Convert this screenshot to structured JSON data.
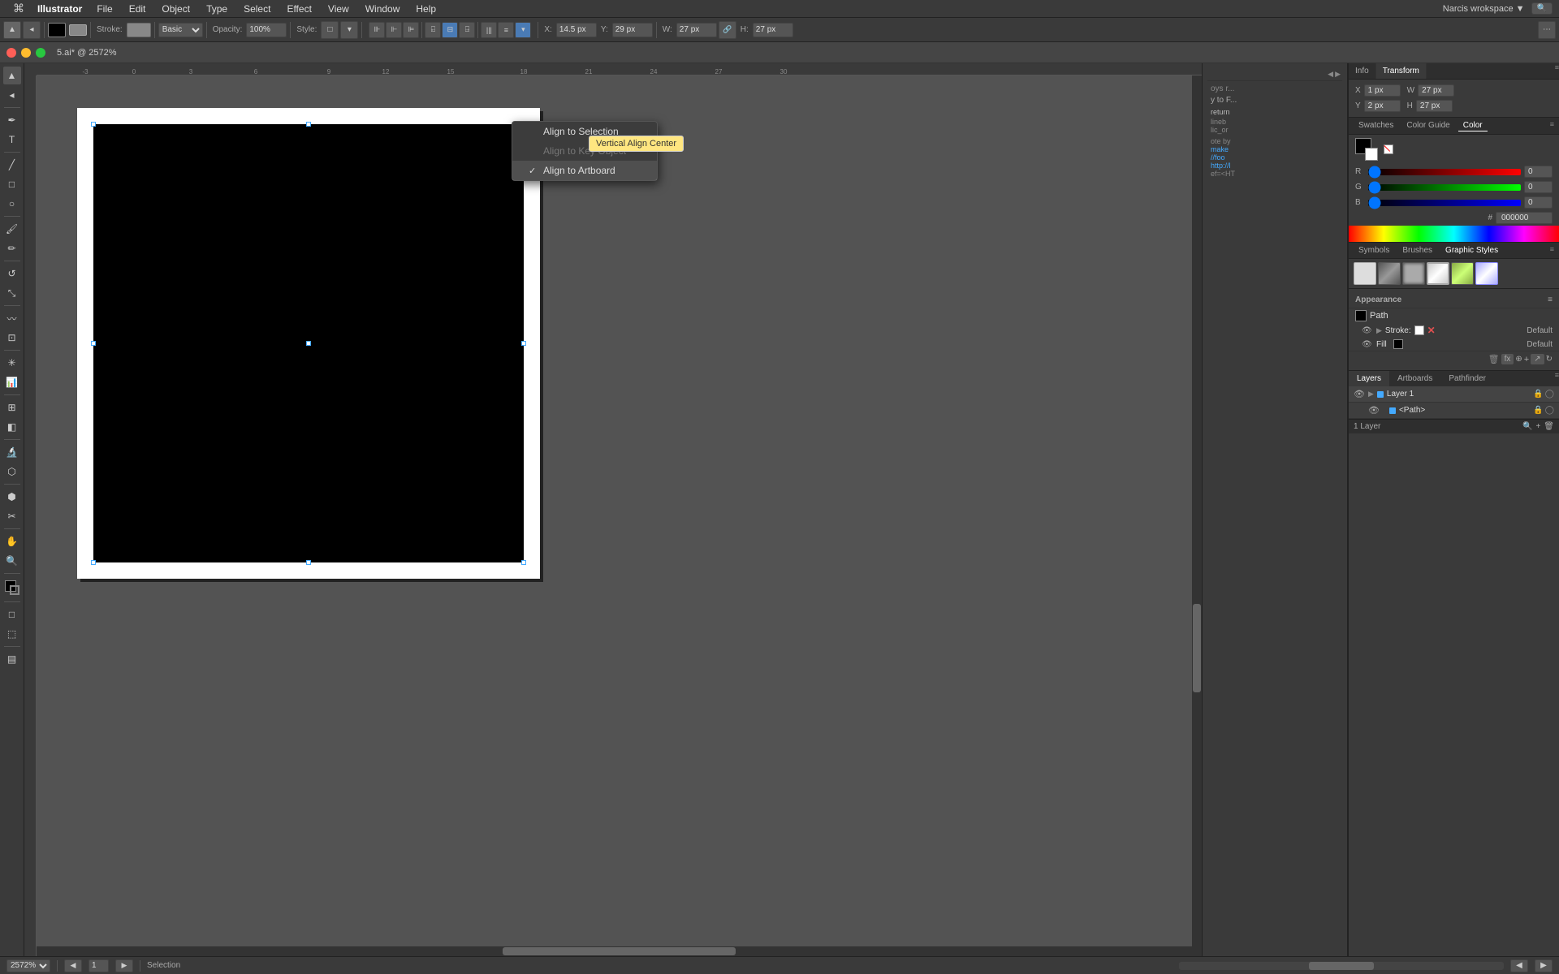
{
  "menubar": {
    "apple": "⌘",
    "app_name": "Illustrator",
    "items": [
      "File",
      "Edit",
      "Object",
      "Type",
      "Select",
      "Effect",
      "View",
      "Window",
      "Help"
    ],
    "right": "Narcis wrokspace ▼",
    "search_placeholder": "Search"
  },
  "toolbar": {
    "stroke_label": "Stroke:",
    "stroke_color": "#888",
    "opacity_label": "Opacity:",
    "opacity_value": "100%",
    "style_label": "Style:",
    "stroke_dropdown": "Basic",
    "x_label": "X:",
    "x_value": "14.5 px",
    "y_label": "Y:",
    "y_value": "29 px",
    "w_label": "W:",
    "w_value": "27 px",
    "h_label": "H:",
    "h_value": "27 px"
  },
  "titlebar": {
    "doc_name": "5.ai* @ 2572%"
  },
  "align_dropdown": {
    "items": [
      {
        "label": "Align to Selection",
        "checked": false,
        "id": "selection"
      },
      {
        "label": "Align to Key Object",
        "checked": false,
        "id": "key_object",
        "dimmed": true
      },
      {
        "label": "Align to Artboard",
        "checked": true,
        "id": "artboard"
      }
    ],
    "tooltip": "Vertical Align Center"
  },
  "canvas": {
    "zoom": "2572%",
    "page": "1",
    "tool": "Selection"
  },
  "right_panel": {
    "info_tab": "Info",
    "transform_tab": "Transform",
    "coords": {
      "x_label": "X",
      "x_value": "1 px",
      "y_label": "Y",
      "y_value": "2 px",
      "w_label": "W",
      "w_value": "27 px",
      "h_label": "H",
      "h_value": "27 px"
    },
    "color_panel": {
      "tabs": [
        "Swatches",
        "Color Guide",
        "Color"
      ],
      "active_tab": "Color",
      "r_label": "R",
      "r_value": "0",
      "g_label": "G",
      "g_value": "0",
      "b_label": "B",
      "b_value": "0",
      "hex_value": "000000"
    },
    "styles_panel": {
      "tabs": [
        "Symbols",
        "Brushes",
        "Graphic Styles"
      ],
      "active_tab": "Graphic Styles",
      "swatches": [
        "",
        "",
        "",
        "",
        "",
        ""
      ]
    },
    "appearance_panel": {
      "title": "Appearance",
      "path_label": "Path",
      "stroke_label": "Stroke:",
      "stroke_opacity": "Default",
      "fill_label": "Fill",
      "fill_opacity": "Default"
    },
    "layers_panel": {
      "tabs": [
        "Layers",
        "Artboards",
        "Pathfinder"
      ],
      "active_tab": "Layers",
      "layers": [
        {
          "name": "Layer 1",
          "color": "#4af",
          "sub": false
        },
        {
          "name": "<Path>",
          "color": "#4af",
          "sub": true
        }
      ],
      "footer_text": "1 Layer"
    }
  },
  "bottom_bar": {
    "zoom": "2572%",
    "page_prev": "◀",
    "page_num": "1",
    "page_next": "▶",
    "tool_name": "Selection",
    "artboard_nav": "◀ ▶"
  }
}
